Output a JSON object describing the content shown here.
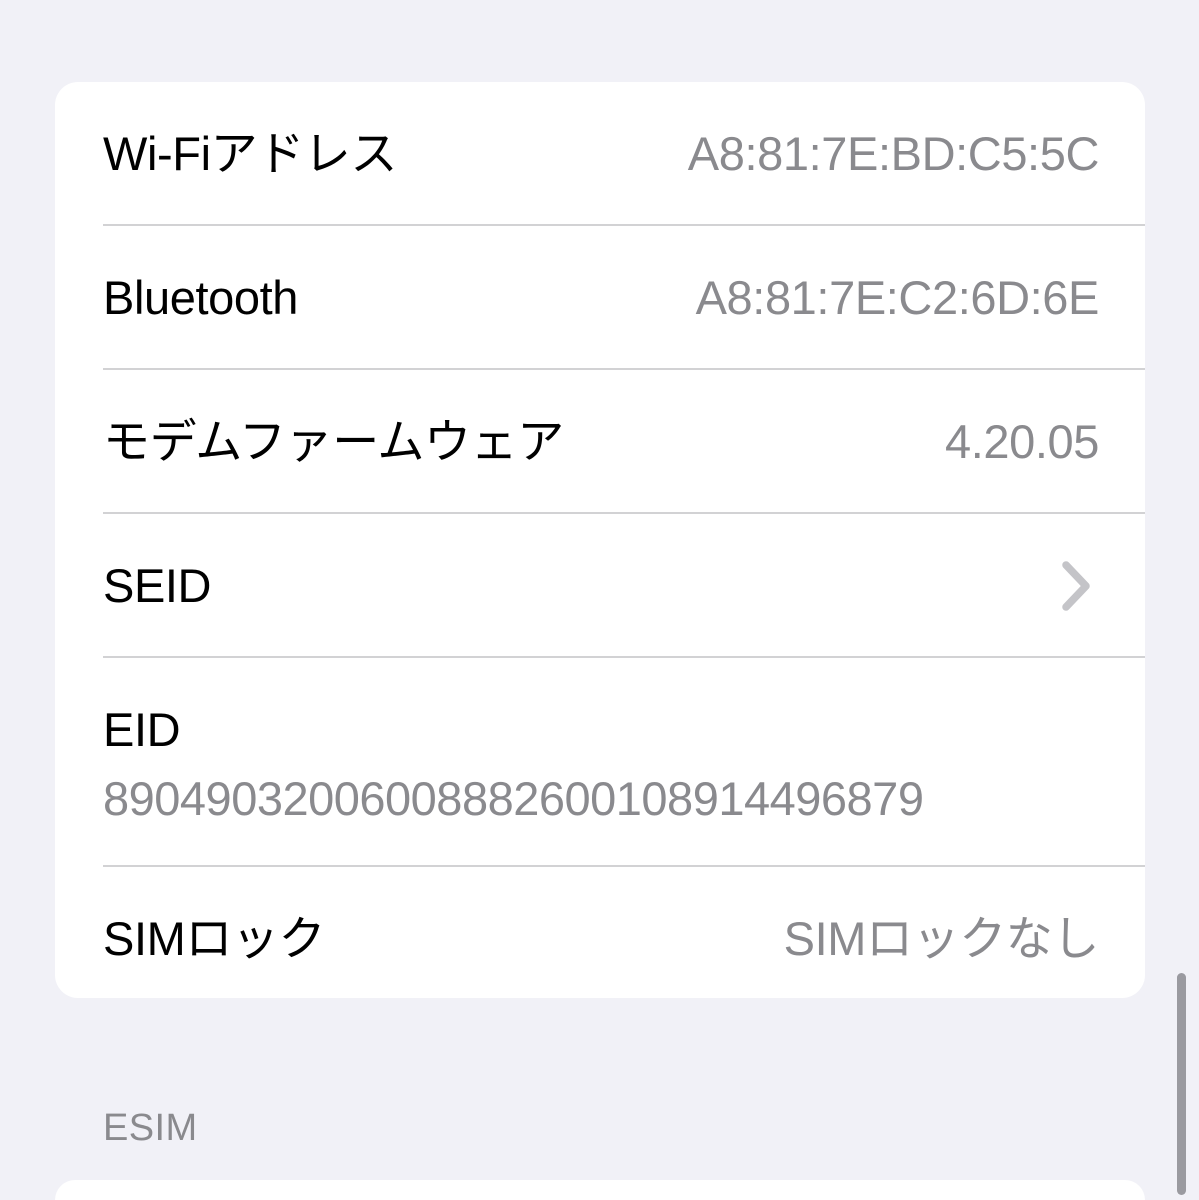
{
  "page": {
    "background_color": "#f1f1f7",
    "card_background_color": "#ffffff",
    "label_color": "#000000",
    "value_color": "#8a8a8e",
    "separator_color": "#d2d2d4",
    "chevron_color": "#c4c4c8"
  },
  "group_one": {
    "rows": [
      {
        "label": "Wi-Fiアドレス",
        "value": "A8:81:7E:BD:C5:5C",
        "type": "value",
        "name": "wifi-address"
      },
      {
        "label": "Bluetooth",
        "value": "A8:81:7E:C2:6D:6E",
        "type": "value",
        "name": "bluetooth-address"
      },
      {
        "label": "モデムファームウェア",
        "value": "4.20.05",
        "type": "value",
        "name": "modem-firmware"
      },
      {
        "label": "SEID",
        "value": "",
        "type": "disclosure",
        "name": "seid",
        "icon": "chevron-right-icon"
      },
      {
        "label": "EID",
        "value": "89049032006008882600108914496879",
        "type": "stacked",
        "name": "eid"
      },
      {
        "label": "SIMロック",
        "value": "SIMロックなし",
        "type": "value",
        "name": "sim-lock"
      }
    ]
  },
  "section_header": {
    "label": "ESIM"
  },
  "scrollbar": {
    "name": "vertical-scroll-indicator"
  }
}
